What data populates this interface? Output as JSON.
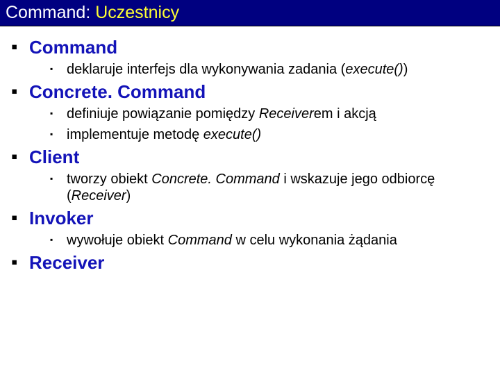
{
  "title": {
    "first": "Command: ",
    "second": "Uczestnicy"
  },
  "sections": [
    {
      "heading": "Command",
      "items": [
        {
          "pre": "deklaruje interfejs dla wykonywania zadania (",
          "em": "execute()",
          "post": ")"
        }
      ]
    },
    {
      "heading": "Concrete. Command",
      "items": [
        {
          "pre": "definiuje powiązanie pomiędzy ",
          "em": "Receiver",
          "post": "em i akcją"
        },
        {
          "pre": "implementuje metodę ",
          "em": "execute()",
          "post": ""
        }
      ]
    },
    {
      "heading": "Client",
      "items": [
        {
          "pre": "tworzy obiekt ",
          "em": "Concrete. Command",
          "post": " i wskazuje jego odbiorcę (",
          "em2": "Receiver",
          "post2": ")"
        }
      ]
    },
    {
      "heading": "Invoker",
      "items": [
        {
          "pre": "wywołuje obiekt ",
          "em": "Command",
          "post": " w celu wykonania żądania"
        }
      ]
    },
    {
      "heading": "Receiver",
      "items": []
    }
  ]
}
